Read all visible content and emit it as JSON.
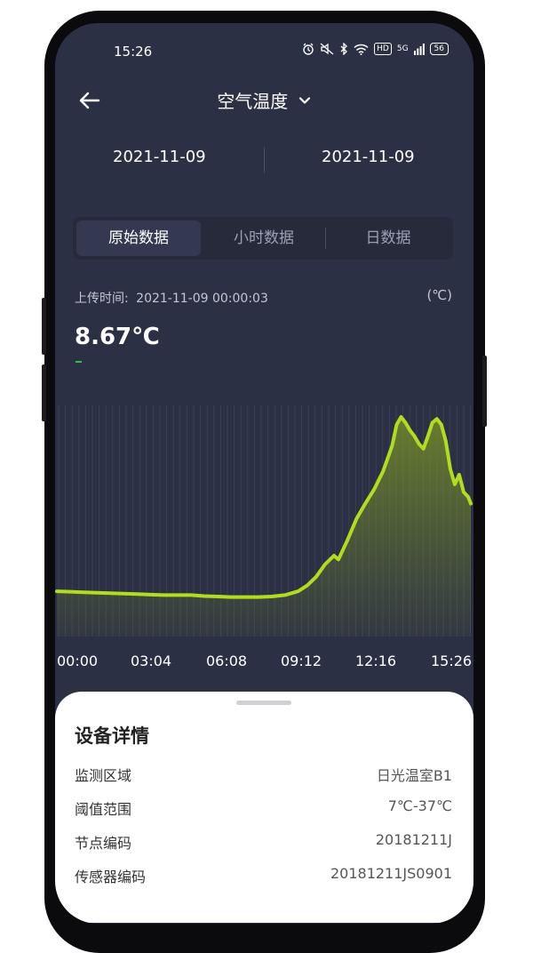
{
  "status_bar": {
    "time": "15:26",
    "hd_label": "HD",
    "network_label": "5G",
    "battery_level": "56"
  },
  "header": {
    "title": "空气温度",
    "back_icon": "arrow-left-icon",
    "dropdown_icon": "chevron-down-icon"
  },
  "date_range": {
    "start": "2021-11-09",
    "end": "2021-11-09"
  },
  "tabs": [
    {
      "label": "原始数据",
      "active": true
    },
    {
      "label": "小时数据",
      "active": false
    },
    {
      "label": "日数据",
      "active": false
    }
  ],
  "reading": {
    "upload_label": "上传时间:",
    "upload_time": "2021-11-09 00:00:03",
    "unit": "(℃)",
    "value": "8.67℃"
  },
  "chart_data": {
    "type": "area",
    "x_labels": [
      "00:00",
      "03:04",
      "06:08",
      "09:12",
      "12:16",
      "15:26"
    ],
    "x_minutes": [
      0,
      30,
      60,
      90,
      120,
      150,
      180,
      210,
      240,
      270,
      300,
      330,
      360,
      390,
      420,
      450,
      480,
      510,
      540,
      560,
      580,
      600,
      620,
      630,
      650,
      670,
      690,
      710,
      730,
      750,
      760,
      770,
      780,
      790,
      800,
      810,
      820,
      830,
      840,
      850,
      860,
      870,
      880,
      890,
      900,
      910,
      920,
      926
    ],
    "values": [
      8.7,
      8.65,
      8.6,
      8.55,
      8.5,
      8.45,
      8.4,
      8.35,
      8.3,
      8.3,
      8.3,
      8.2,
      8.15,
      8.1,
      8.1,
      8.1,
      8.15,
      8.3,
      8.7,
      9.3,
      10.2,
      11.5,
      12.4,
      12.0,
      14.0,
      16.2,
      17.8,
      19.3,
      21.2,
      23.8,
      26.0,
      26.8,
      26.2,
      25.4,
      24.8,
      24.0,
      23.5,
      24.8,
      26.2,
      26.6,
      26.0,
      24.3,
      21.4,
      19.8,
      20.8,
      19.0,
      18.5,
      17.8
    ],
    "y_range": [
      4,
      28
    ],
    "line_color": "#b0de1e",
    "area_color": "#7b9527"
  },
  "device_details": {
    "title": "设备详情",
    "rows": [
      {
        "label": "监测区域",
        "value": "日光温室B1"
      },
      {
        "label": "阈值范围",
        "value": "7℃-37℃"
      },
      {
        "label": "节点编码",
        "value": "20181211J"
      },
      {
        "label": "传感器编码",
        "value": "20181211JS0901"
      }
    ]
  }
}
